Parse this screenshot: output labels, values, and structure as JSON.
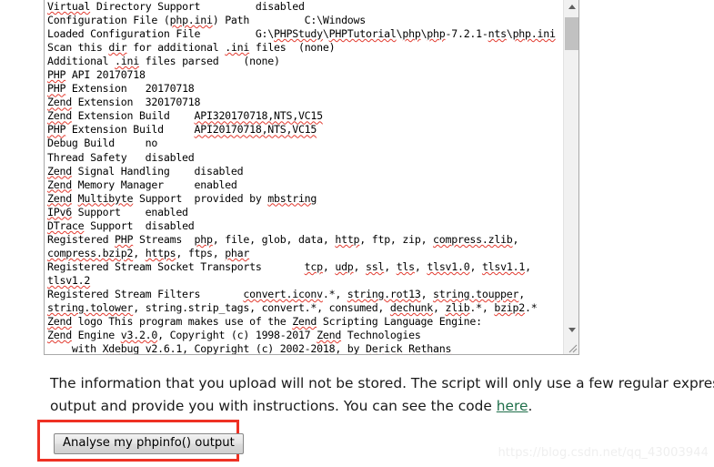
{
  "textarea": {
    "name": "phpinfo-paste-area",
    "content": "Virtual Directory Support         disabled\nConfiguration File (php.ini) Path         C:\\Windows\nLoaded Configuration File         G:\\PHPStudy\\PHPTutorial\\php\\php-7.2.1-nts\\php.ini\nScan this dir for additional .ini files  (none)\nAdditional .ini files parsed    (none)\nPHP API 20170718\nPHP Extension   20170718\nZend Extension  320170718\nZend Extension Build    API320170718,NTS,VC15\nPHP Extension Build     API20170718,NTS,VC15\nDebug Build     no\nThread Safety   disabled\nZend Signal Handling    disabled\nZend Memory Manager     enabled\nZend Multibyte Support  provided by mbstring\nIPv6 Support    enabled\nDTrace Support  disabled\nRegistered PHP Streams  php, file, glob, data, http, ftp, zip, compress.zlib, compress.bzip2, https, ftps, phar\nRegistered Stream Socket Transports       tcp, udp, ssl, tls, tlsv1.0, tlsv1.1, tlsv1.2\nRegistered Stream Filters       convert.iconv.*, string.rot13, string.toupper, string.tolower, string.strip_tags, convert.*, consumed, dechunk, zlib.*, bzip2.*\nZend logo This program makes use of the Zend Scripting Language Engine:\nZend Engine v3.2.0, Copyright (c) 1998-2017 Zend Technologies\n    with Xdebug v2.6.1, Copyright (c) 2002-2018, by Derick Rethans",
    "lines": [
      {
        "label": "Virtual Directory Support",
        "value": "disabled"
      },
      {
        "label": "Configuration File (php.ini) Path",
        "value": "C:\\Windows"
      },
      {
        "label": "Loaded Configuration File",
        "value": "G:\\PHPStudy\\PHPTutorial\\php\\php-7.2.1-nts\\php.ini"
      },
      {
        "label": "Scan this dir for additional .ini files",
        "value": "(none)"
      },
      {
        "label": "Additional .ini files parsed",
        "value": "(none)"
      },
      {
        "label": "PHP API",
        "value": "20170718"
      },
      {
        "label": "PHP Extension",
        "value": "20170718"
      },
      {
        "label": "Zend Extension",
        "value": "320170718"
      },
      {
        "label": "Zend Extension Build",
        "value": "API320170718,NTS,VC15"
      },
      {
        "label": "PHP Extension Build",
        "value": "API20170718,NTS,VC15"
      },
      {
        "label": "Debug Build",
        "value": "no"
      },
      {
        "label": "Thread Safety",
        "value": "disabled"
      },
      {
        "label": "Zend Signal Handling",
        "value": "disabled"
      },
      {
        "label": "Zend Memory Manager",
        "value": "enabled"
      },
      {
        "label": "Zend Multibyte Support",
        "value": "provided by mbstring"
      },
      {
        "label": "IPv6 Support",
        "value": "enabled"
      },
      {
        "label": "DTrace Support",
        "value": "disabled"
      },
      {
        "label": "Registered PHP Streams",
        "value": "php, file, glob, data, http, ftp, zip, compress.zlib, compress.bzip2, https, ftps, phar"
      },
      {
        "label": "Registered Stream Socket Transports",
        "value": "tcp, udp, ssl, tls, tlsv1.0, tlsv1.1, tlsv1.2"
      },
      {
        "label": "Registered Stream Filters",
        "value": "convert.iconv.*, string.rot13, string.toupper, string.tolower, string.strip_tags, convert.*, consumed, dechunk, zlib.*, bzip2.*"
      },
      {
        "label": "Zend logo This program makes use of the Zend Scripting Language Engine:",
        "value": ""
      },
      {
        "label": "Zend Engine v3.2.0, Copyright (c) 1998-2017 Zend Technologies",
        "value": ""
      },
      {
        "label": "    with Xdebug v2.6.1, Copyright (c) 2002-2018, by Derick Rethans",
        "value": ""
      }
    ]
  },
  "scrollbar": {
    "up_arrow_icon": "triangle-up-icon",
    "down_arrow_icon": "triangle-down-icon",
    "thumb_position_percent": 5,
    "resize_grip_icon": "resize-grip-icon"
  },
  "paragraph": {
    "line1": "The information that you upload will not be stored. The script will only use a few regular expres",
    "line2_before_link": "output and provide you with instructions. You can see the code ",
    "link_text": "here",
    "line2_after_link": "."
  },
  "button": {
    "label": "Analyse my phpinfo() output"
  },
  "annotation": {
    "color": "#ee3124",
    "shape": "rectangle"
  },
  "watermark": {
    "text": "https://blog.csdn.net/qq_43003944",
    "color": "#efefef"
  }
}
